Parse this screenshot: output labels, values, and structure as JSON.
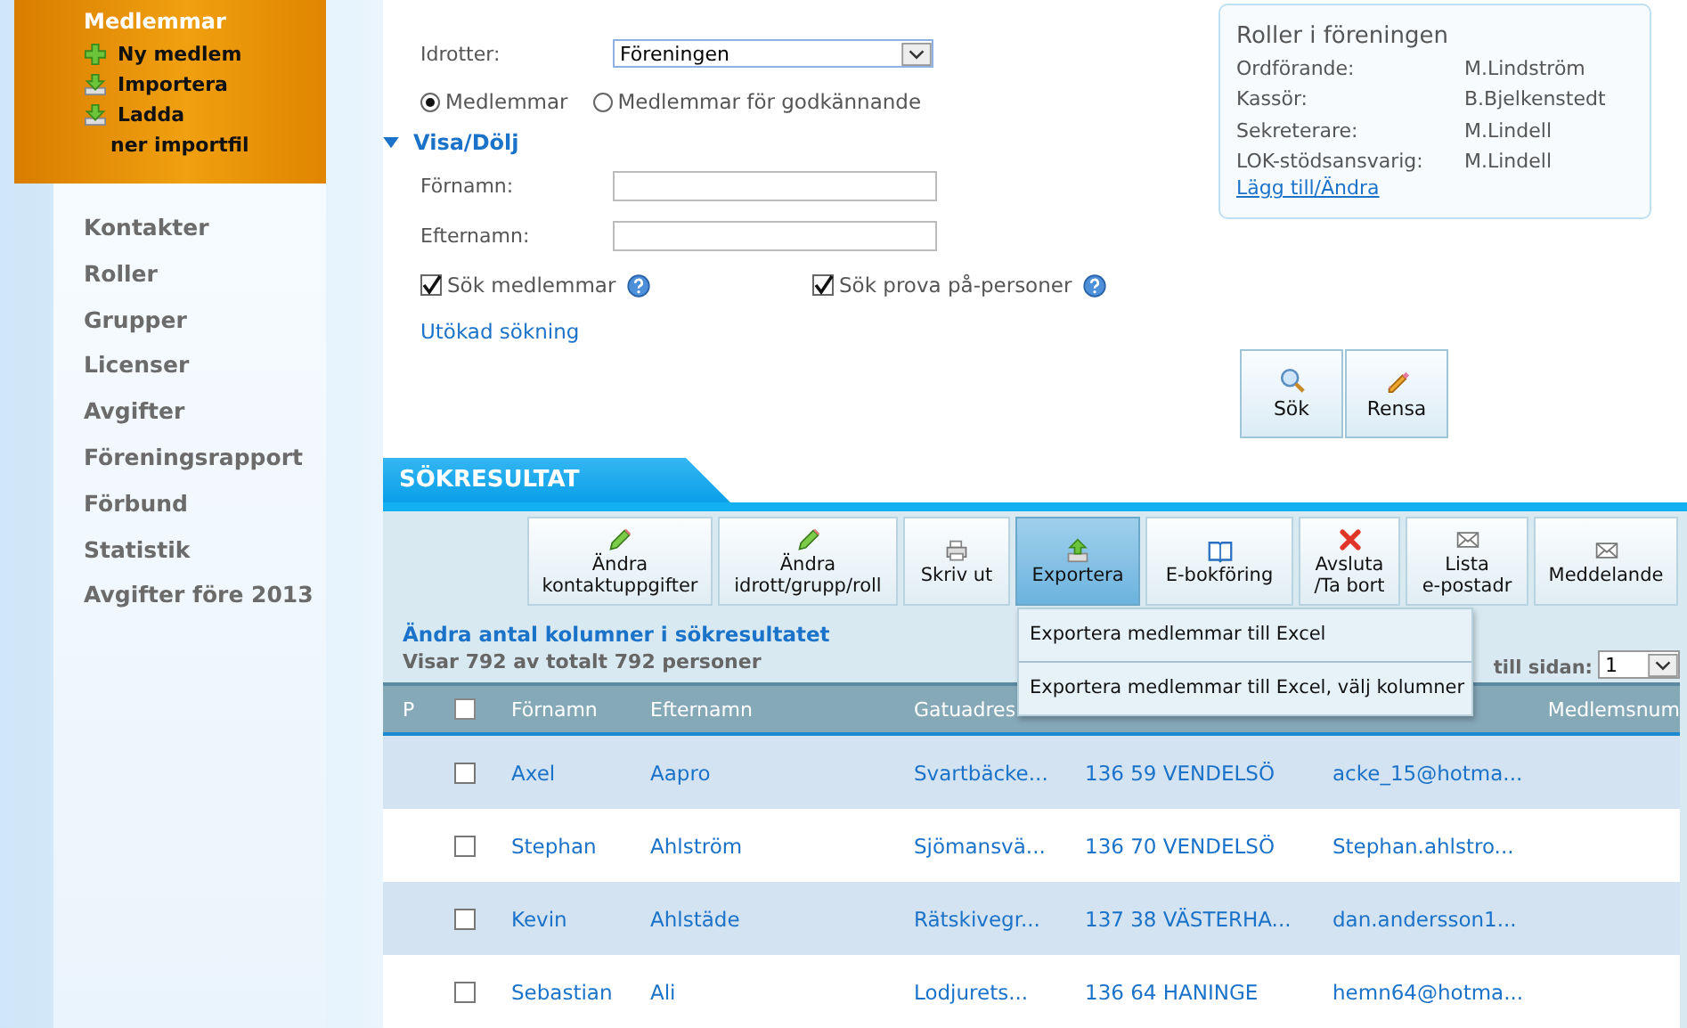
{
  "sidebar": {
    "header": {
      "title": "Medlemmar",
      "actions": [
        {
          "kind": "add",
          "lines": [
            "Ny medlem"
          ]
        },
        {
          "kind": "import",
          "lines": [
            "Importera"
          ]
        },
        {
          "kind": "import",
          "lines": [
            "Ladda",
            "ner importfil"
          ]
        }
      ]
    },
    "items": [
      "Kontakter",
      "Roller",
      "Grupper",
      "Licenser",
      "Avgifter",
      "Föreningsrapport",
      "Förbund",
      "Statistik",
      "Avgifter före 2013"
    ]
  },
  "search": {
    "sport_label": "Idrotter:",
    "sport_value": "Föreningen",
    "radios": [
      {
        "label": "Medlemmar",
        "selected": true
      },
      {
        "label": "Medlemmar för godkännande",
        "selected": false
      }
    ],
    "toggle": {
      "label": "Visa/Dölj",
      "expanded": true
    },
    "fields": [
      {
        "label": "Förnamn:"
      },
      {
        "label": "Efternamn:"
      }
    ],
    "checkboxes": [
      {
        "label": "Sök medlemmar",
        "checked": true
      },
      {
        "label": "Sök prova på-personer",
        "checked": true
      }
    ],
    "advanced_link": "Utökad sökning",
    "buttons": [
      {
        "kind": "search",
        "label": "Sök"
      },
      {
        "kind": "clear",
        "label": "Rensa"
      }
    ]
  },
  "roles": {
    "title": "Roller i föreningen",
    "rows": [
      {
        "role": "Ordförande:",
        "name": "M.Lindström"
      },
      {
        "role": "Kassör:",
        "name": "B.Bjelkenstedt"
      },
      {
        "role": "Sekreterare:",
        "name": "M.Lindell"
      },
      {
        "role": "LOK-stödsansvarig:",
        "name": "M.Lindell"
      }
    ],
    "link": "Lägg till/Ändra"
  },
  "results": {
    "tab": "SÖKRESULTAT",
    "toolbar": [
      {
        "kind": "edit",
        "lines": [
          "Ändra",
          "kontaktuppgifter"
        ],
        "selected": false
      },
      {
        "kind": "edit",
        "lines": [
          "Ändra",
          "idrott/grupp/roll"
        ],
        "selected": false
      },
      {
        "kind": "print",
        "lines": [
          "Skriv ut"
        ],
        "selected": false
      },
      {
        "kind": "export",
        "lines": [
          "Exportera"
        ],
        "selected": true
      },
      {
        "kind": "book",
        "lines": [
          "E-bokföring"
        ],
        "selected": false
      },
      {
        "kind": "delete",
        "lines": [
          "Avsluta",
          "/Ta bort"
        ],
        "selected": false
      },
      {
        "kind": "mail",
        "lines": [
          "Lista",
          "e-postadr"
        ],
        "selected": false
      },
      {
        "kind": "mail",
        "lines": [
          "Meddelande"
        ],
        "selected": false
      }
    ],
    "export_menu": [
      "Exportera medlemmar till Excel",
      "Exportera medlemmar till Excel, välj kolumner"
    ],
    "columns_link": "Ändra antal kolumner i sökresultatet",
    "count": "Visar 792 av totalt 792 personer",
    "per_page_label": "till sidan:",
    "per_page_value": "1",
    "table": {
      "p_header": "P",
      "select_all": false,
      "columns": [
        "Förnamn",
        "Efternamn",
        "Gatuadres",
        "Medlemsnum"
      ],
      "rows": [
        {
          "checked": false,
          "cells": [
            "Axel",
            "Aapro",
            "Svartbäcke...",
            "136 59 VENDELSÖ",
            "acke_15@hotma..."
          ]
        },
        {
          "checked": false,
          "cells": [
            "Stephan",
            "Ahlström",
            "Sjömansvä...",
            "136 70 VENDELSÖ",
            "Stephan.ahlstro..."
          ]
        },
        {
          "checked": false,
          "cells": [
            "Kevin",
            "Ahlstäde",
            "Rätskivegr...",
            "137 38 VÄSTERHA...",
            "dan.andersson1..."
          ]
        },
        {
          "checked": false,
          "cells": [
            "Sebastian",
            "Ali",
            "Lodjurets...",
            "136 64 HANINGE",
            "hemn64@hotma..."
          ]
        }
      ]
    }
  }
}
